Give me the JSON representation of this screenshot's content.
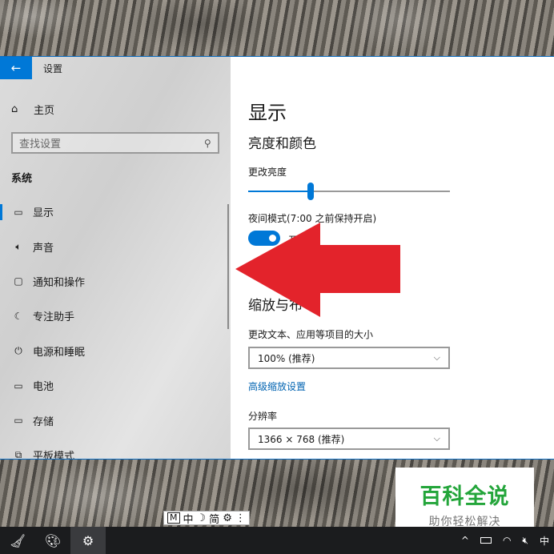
{
  "window": {
    "title": "设置",
    "back_glyph": "←"
  },
  "sidebar": {
    "home_label": "主页",
    "search_placeholder": "查找设置",
    "section_label": "系统",
    "items": [
      {
        "label": "显示",
        "icon": "monitor-icon",
        "glyph": "▭",
        "active": true
      },
      {
        "label": "声音",
        "icon": "speaker-icon",
        "glyph": "🔈︎"
      },
      {
        "label": "通知和操作",
        "icon": "notification-icon",
        "glyph": "▢"
      },
      {
        "label": "专注助手",
        "icon": "moon-icon",
        "glyph": "☾"
      },
      {
        "label": "电源和睡眠",
        "icon": "power-icon",
        "glyph": "⏻"
      },
      {
        "label": "电池",
        "icon": "battery-icon",
        "glyph": "▭"
      },
      {
        "label": "存储",
        "icon": "storage-icon",
        "glyph": "▭"
      },
      {
        "label": "平板模式",
        "icon": "tablet-mode-icon",
        "glyph": "⧉"
      }
    ]
  },
  "content": {
    "title": "显示",
    "brightness_section": "亮度和颜色",
    "brightness_label": "更改亮度",
    "brightness_value": 0.31,
    "night_mode_label": "夜间模式(7:00 之前保持开启)",
    "night_mode_state": "开",
    "scale_section": "缩放与布",
    "scale_label": "更改文本、应用等项目的大小",
    "scale_value": "100% (推荐)",
    "advanced_scaling_link": "高级缩放设置",
    "resolution_label": "分辨率",
    "resolution_value": "1366 × 768 (推荐)"
  },
  "watermark": {
    "main": "百科全说",
    "sub": "助你轻松解决"
  },
  "ime": {
    "mode": "M",
    "lang": "中",
    "moon": "☽",
    "charset": "简",
    "gear": "⚙",
    "more": "⋮"
  },
  "taskbar": {
    "tray_lang": "中",
    "chevron": "^"
  },
  "colors": {
    "accent": "#0078d7",
    "arrow_red": "#e3232b",
    "watermark_green": "#23a53a"
  }
}
